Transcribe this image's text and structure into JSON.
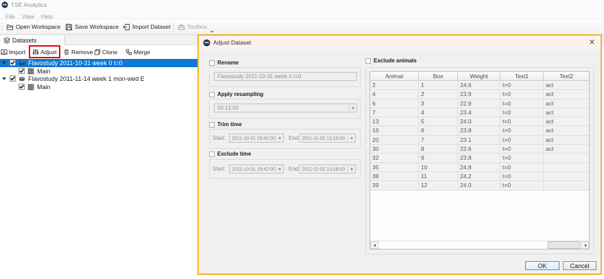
{
  "window": {
    "title": "TSE Analytics",
    "logo": "TSE"
  },
  "menu": {
    "items": [
      {
        "label": "File"
      },
      {
        "label": "View"
      },
      {
        "label": "Help"
      }
    ]
  },
  "toolbar": {
    "items": [
      {
        "label": "Open Workspace",
        "icon": "open-workspace-icon",
        "disabled": false
      },
      {
        "label": "Save Workspace",
        "icon": "save-workspace-icon",
        "disabled": false
      },
      {
        "label": "Import Dataset",
        "icon": "import-dataset-icon",
        "disabled": false
      },
      {
        "label": "Toolbox",
        "icon": "toolbox-icon",
        "disabled": true,
        "has_menu_arrow": true
      }
    ]
  },
  "datasets_panel": {
    "tab_label": "Datasets",
    "tab_icon": "datasets-icon",
    "toolbar": [
      {
        "label": "Import",
        "icon": "import-icon",
        "annotated": false
      },
      {
        "label": "Adjust",
        "icon": "adjust-sliders-icon",
        "annotated": true
      },
      {
        "label": "Remove",
        "icon": "remove-trash-icon",
        "annotated": false
      },
      {
        "label": "Clone",
        "icon": "clone-icon",
        "annotated": false
      },
      {
        "label": "Merge",
        "icon": "merge-icon",
        "annotated": false
      }
    ],
    "tree": [
      {
        "label": "Flavostudy 2011-10-31 week 0 t=0",
        "level": 0,
        "icon": "dataset-icon",
        "checked": true,
        "selected": true,
        "expanded": true
      },
      {
        "label": "Main",
        "level": 1,
        "icon": "datatable-icon",
        "checked": true,
        "selected": false,
        "expanded": null
      },
      {
        "label": "Flavostudy 2011-11-14 week 1 mon-wed E",
        "level": 0,
        "icon": "dataset-icon",
        "checked": true,
        "selected": false,
        "expanded": true
      },
      {
        "label": "Main",
        "level": 1,
        "icon": "datatable-icon",
        "checked": true,
        "selected": false,
        "expanded": null
      }
    ]
  },
  "annotation": {
    "color": "#e70000",
    "target": "Adjust button"
  },
  "dialog": {
    "title": "Adjust Dataset",
    "close_icon": "close-icon",
    "sections": {
      "rename": {
        "label": "Rename",
        "checked": false,
        "value": "Flavostudy 2011-10-31 week 0 t=0"
      },
      "resampling": {
        "label": "Apply resampling",
        "checked": false,
        "value": "00:12:00"
      },
      "trim_time": {
        "label": "Trim time",
        "checked": false,
        "start_label": "Start:",
        "start_value": "2011-10-31 15:42:00",
        "end_label": "End:",
        "end_value": "2011-11-02 13:18:00"
      },
      "exclude_time": {
        "label": "Exclude time",
        "checked": false,
        "start_label": "Start:",
        "start_value": "2011-10-31 15:42:00",
        "end_label": "End:",
        "end_value": "2011-11-02 13:18:00"
      },
      "exclude_animals": {
        "label": "Exclude animals",
        "checked": false
      }
    },
    "table": {
      "columns": [
        "Animal",
        "Box",
        "Weight",
        "Text1",
        "Text2"
      ],
      "rows": [
        [
          "2",
          "1",
          "24.6",
          "t=0",
          "act"
        ],
        [
          "4",
          "2",
          "23.9",
          "t=0",
          "act"
        ],
        [
          "6",
          "3",
          "22.9",
          "t=0",
          "act"
        ],
        [
          "7",
          "4",
          "23.4",
          "t=0",
          "act"
        ],
        [
          "13",
          "5",
          "24.0",
          "t=0",
          "act"
        ],
        [
          "16",
          "6",
          "23.8",
          "t=0",
          "act"
        ],
        [
          "20",
          "7",
          "23.1",
          "t=0",
          "act"
        ],
        [
          "30",
          "8",
          "22.6",
          "t=0",
          "act"
        ],
        [
          "32",
          "9",
          "23.8",
          "t=0",
          ""
        ],
        [
          "35",
          "10",
          "24.8",
          "t=0",
          ""
        ],
        [
          "38",
          "11",
          "24.2",
          "t=0",
          ""
        ],
        [
          "39",
          "12",
          "24.0",
          "t=0",
          ""
        ]
      ]
    },
    "buttons": {
      "ok": "OK",
      "cancel": "Cancel"
    },
    "colors": {
      "border": "#f3b31c",
      "selection": "#0f77d4"
    }
  }
}
